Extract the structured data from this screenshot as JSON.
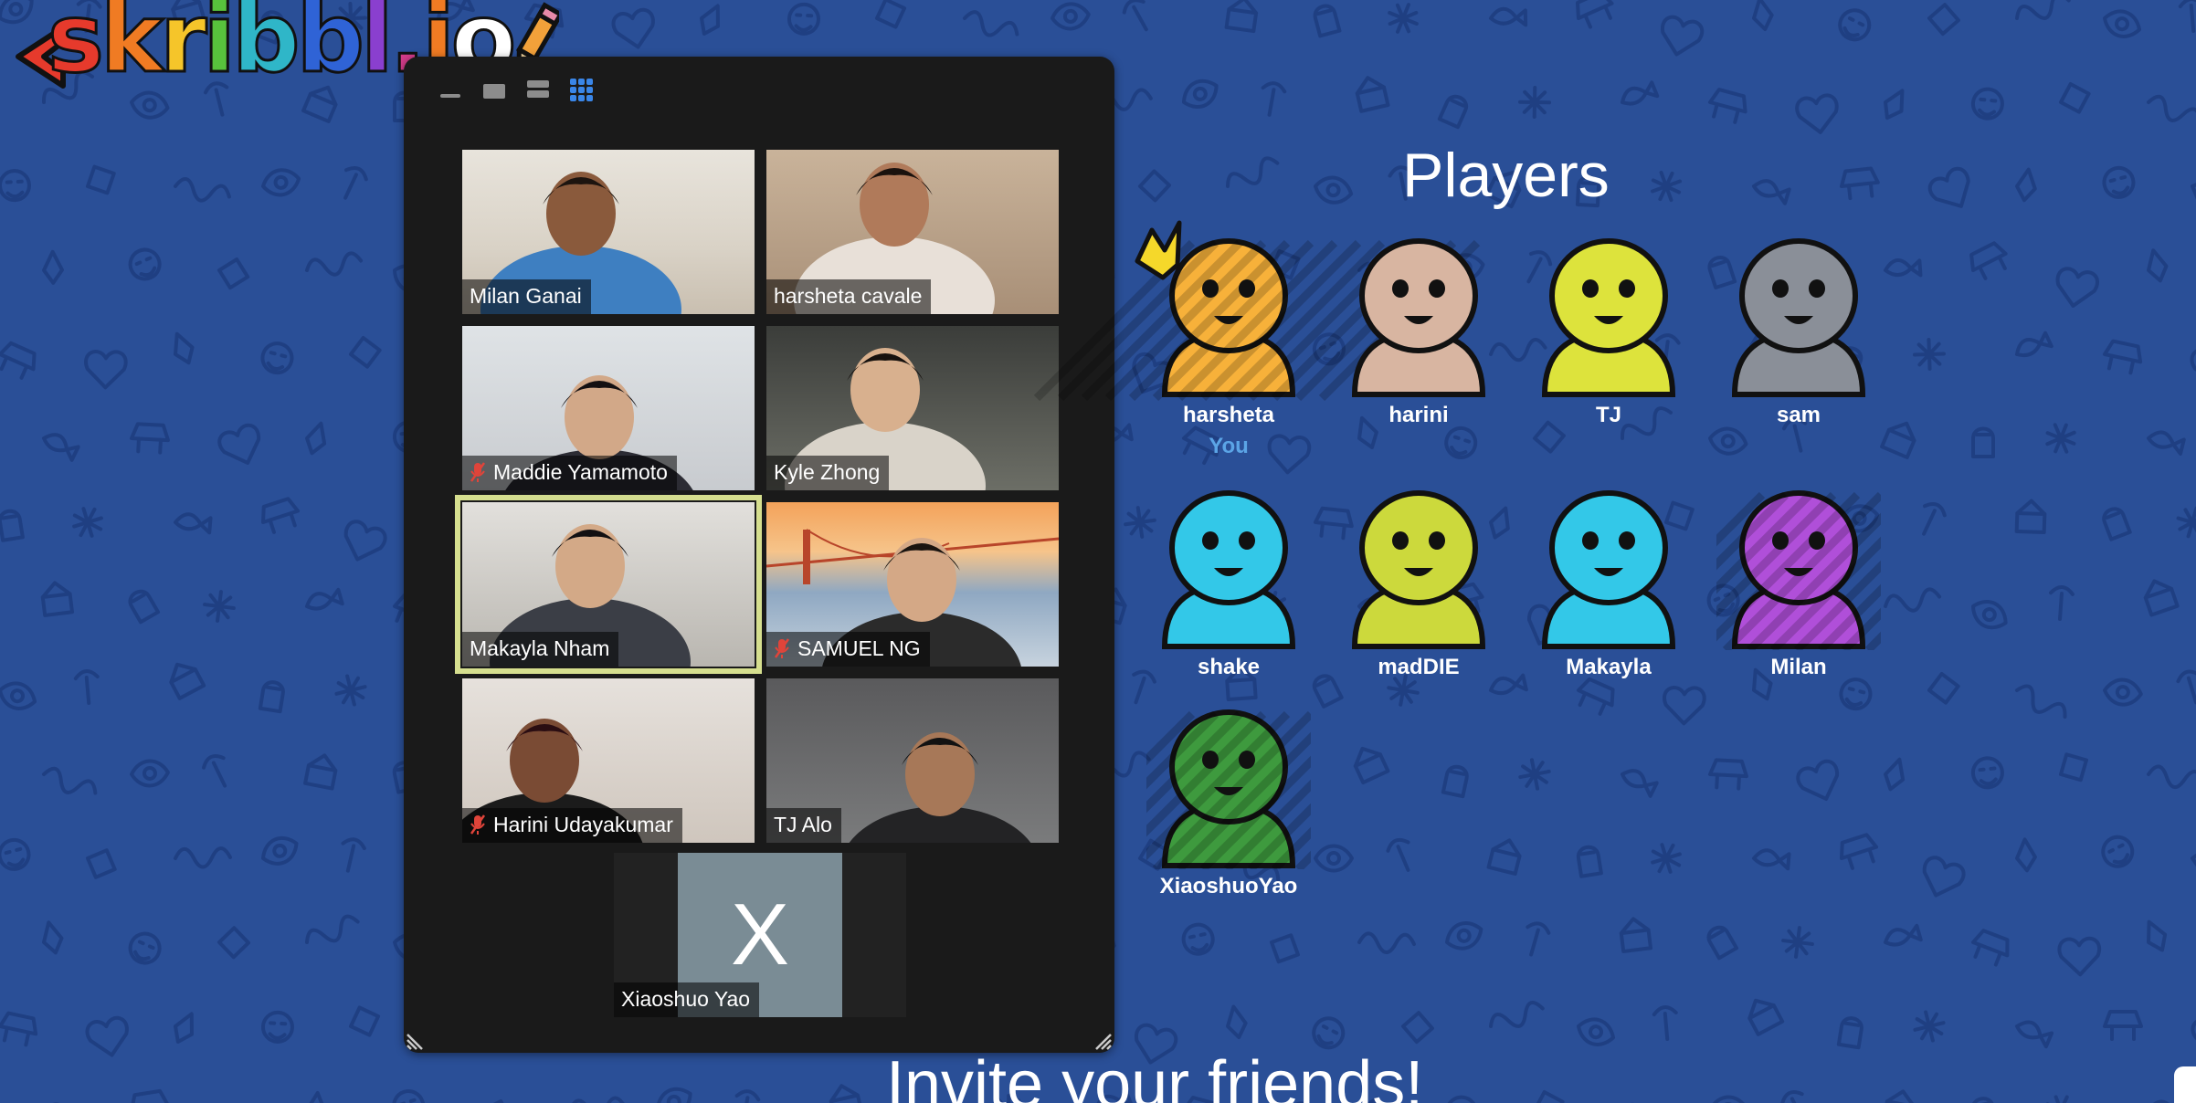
{
  "app": {
    "logo_text": "skribbl.io"
  },
  "zoom": {
    "view_buttons": [
      "minimize-view",
      "speaker-view",
      "strip-view",
      "gallery-view"
    ],
    "active_view": "gallery-view",
    "participants": [
      {
        "name": "Milan Ganai",
        "muted": false,
        "speaking": false
      },
      {
        "name": "harsheta cavale",
        "muted": false,
        "speaking": false
      },
      {
        "name": "Maddie Yamamoto",
        "muted": true,
        "speaking": false
      },
      {
        "name": "Kyle Zhong",
        "muted": false,
        "speaking": false
      },
      {
        "name": "Makayla Nham",
        "muted": false,
        "speaking": true
      },
      {
        "name": "SAMUEL NG",
        "muted": true,
        "speaking": false
      },
      {
        "name": "Harini Udayakumar",
        "muted": true,
        "speaking": false
      },
      {
        "name": "TJ Alo",
        "muted": false,
        "speaking": false
      },
      {
        "name": "Xiaoshuo Yao",
        "muted": false,
        "speaking": false,
        "avatar_letter": "X"
      }
    ]
  },
  "players": {
    "title": "Players",
    "you_label": "You",
    "list": [
      {
        "name": "harsheta",
        "is_you": true,
        "owner": true,
        "color": "#f7b13a"
      },
      {
        "name": "harini",
        "is_you": false,
        "color": "#d8b5a1"
      },
      {
        "name": "TJ",
        "is_you": false,
        "color": "#dde33c"
      },
      {
        "name": "sam",
        "is_you": false,
        "color": "#8a8f98"
      },
      {
        "name": "shake",
        "is_you": false,
        "color": "#33c8e8"
      },
      {
        "name": "madDIE",
        "is_you": false,
        "color": "#ccd93c"
      },
      {
        "name": "Makayla",
        "is_you": false,
        "color": "#33c8e8"
      },
      {
        "name": "Milan",
        "is_you": false,
        "color": "#b04fd9"
      },
      {
        "name": "XiaoshuoYao",
        "is_you": false,
        "color": "#3e9a3e"
      }
    ]
  },
  "invite": {
    "title": "Invite your friends!"
  },
  "colors": {
    "background": "#2a4f97",
    "active_view": "#3a86e8",
    "speaking_border": "#d6df8f",
    "you_label": "#5ba4e6"
  }
}
